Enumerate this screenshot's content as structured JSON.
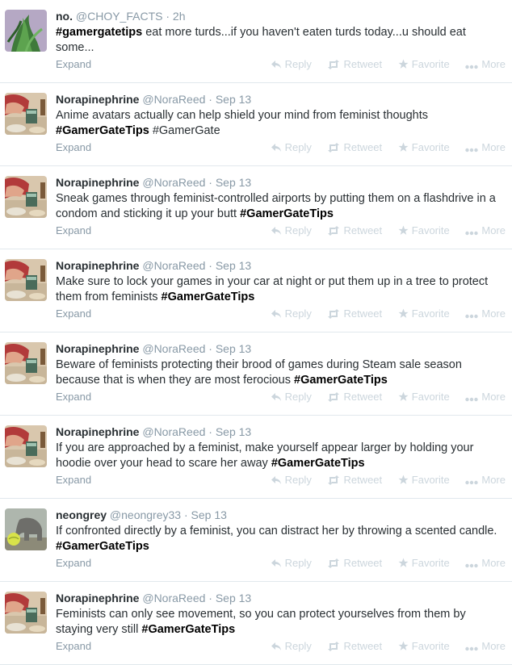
{
  "tweets": [
    {
      "name": "no.",
      "handle": "@CHOY_FACTS",
      "time": "2h",
      "avatar": "green",
      "parts": [
        {
          "t": "#gamergatetips",
          "b": true
        },
        {
          "t": " eat more turds...if you haven't eaten turds today...u should eat some..."
        }
      ]
    },
    {
      "name": "Norapinephrine",
      "handle": "@NoraReed",
      "time": "Sep 13",
      "avatar": "nora",
      "parts": [
        {
          "t": "Anime avatars actually can help shield your mind from feminist thoughts "
        },
        {
          "t": "#GamerGateTips",
          "b": true
        },
        {
          "t": " #GamerGate"
        }
      ]
    },
    {
      "name": "Norapinephrine",
      "handle": "@NoraReed",
      "time": "Sep 13",
      "avatar": "nora",
      "parts": [
        {
          "t": "Sneak games through feminist-controlled airports by putting them on a flashdrive in a condom and sticking it up your butt "
        },
        {
          "t": "#GamerGateTips",
          "b": true
        }
      ]
    },
    {
      "name": "Norapinephrine",
      "handle": "@NoraReed",
      "time": "Sep 13",
      "avatar": "nora",
      "parts": [
        {
          "t": "Make sure to lock your games in your car at night or put them up in a tree to protect them from feminists "
        },
        {
          "t": "#GamerGateTips",
          "b": true
        }
      ]
    },
    {
      "name": "Norapinephrine",
      "handle": "@NoraReed",
      "time": "Sep 13",
      "avatar": "nora",
      "parts": [
        {
          "t": "Beware of feminists protecting their brood of games during Steam sale season because that is when they are most ferocious "
        },
        {
          "t": "#GamerGateTips",
          "b": true
        }
      ]
    },
    {
      "name": "Norapinephrine",
      "handle": "@NoraReed",
      "time": "Sep 13",
      "avatar": "nora",
      "parts": [
        {
          "t": "If you are approached by a feminist, make yourself appear larger by holding your hoodie over your head to scare her away "
        },
        {
          "t": "#GamerGateTips",
          "b": true
        }
      ]
    },
    {
      "name": "neongrey",
      "handle": "@neongrey33",
      "time": "Sep 13",
      "avatar": "elephant",
      "parts": [
        {
          "t": "If confronted directly by a feminist, you can distract her by throwing a scented candle. "
        },
        {
          "t": "#GamerGateTips",
          "b": true
        }
      ]
    },
    {
      "name": "Norapinephrine",
      "handle": "@NoraReed",
      "time": "Sep 13",
      "avatar": "nora",
      "parts": [
        {
          "t": "Feminists can only see movement, so you can protect yourselves from them by staying very still "
        },
        {
          "t": "#GamerGateTips",
          "b": true
        }
      ]
    }
  ],
  "labels": {
    "separator": "·",
    "expand": "Expand",
    "reply": "Reply",
    "retweet": "Retweet",
    "favorite": "Favorite",
    "more": "More"
  }
}
